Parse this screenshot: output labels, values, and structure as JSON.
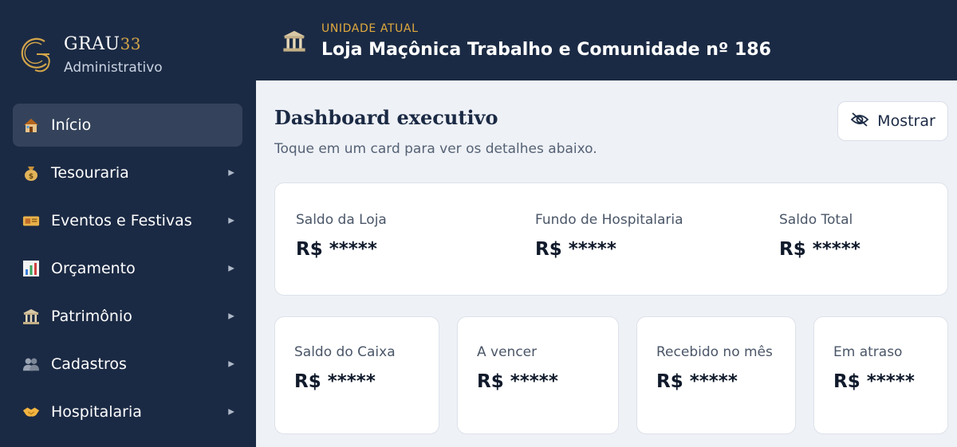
{
  "brand": {
    "name": "GRAU",
    "name_suffix": "33",
    "subtitle": "Administrativo",
    "logo_icon": "g3-logo-icon"
  },
  "sidebar": {
    "items": [
      {
        "label": "Início",
        "icon": "house-icon",
        "active": true,
        "has_submenu": false
      },
      {
        "label": "Tesouraria",
        "icon": "money-bag-icon",
        "active": false,
        "has_submenu": true
      },
      {
        "label": "Eventos e Festivas",
        "icon": "ticket-icon",
        "active": false,
        "has_submenu": true
      },
      {
        "label": "Orçamento",
        "icon": "bar-chart-icon",
        "active": false,
        "has_submenu": true
      },
      {
        "label": "Patrimônio",
        "icon": "classical-building-icon",
        "active": false,
        "has_submenu": true
      },
      {
        "label": "Cadastros",
        "icon": "people-icon",
        "active": false,
        "has_submenu": true
      },
      {
        "label": "Hospitalaria",
        "icon": "handshake-icon",
        "active": false,
        "has_submenu": true
      }
    ]
  },
  "header": {
    "unit_label": "UNIDADE ATUAL",
    "unit_name": "Loja Maçônica Trabalho e Comunidade nº 186",
    "unit_icon": "classical-building-icon"
  },
  "dashboard": {
    "title": "Dashboard executivo",
    "subtitle": "Toque em um card para ver os detalhes abaixo.",
    "show_button_label": "Mostrar",
    "show_button_icon": "eye-off-icon",
    "summary": [
      {
        "label": "Saldo da Loja",
        "value": "R$ *****"
      },
      {
        "label": "Fundo de Hospitalaria",
        "value": "R$ *****"
      },
      {
        "label": "Saldo Total",
        "value": "R$ *****"
      }
    ],
    "cards": [
      {
        "label": "Saldo do Caixa",
        "value": "R$ *****"
      },
      {
        "label": "A vencer",
        "value": "R$ *****"
      },
      {
        "label": "Recebido no mês",
        "value": "R$ *****"
      },
      {
        "label": "Em atraso",
        "value": "R$ *****"
      }
    ]
  },
  "colors": {
    "navy": "#1b2a44",
    "accent_gold": "#e0a93e",
    "active_item": "#34435b",
    "page_bg": "#eef1f6"
  }
}
